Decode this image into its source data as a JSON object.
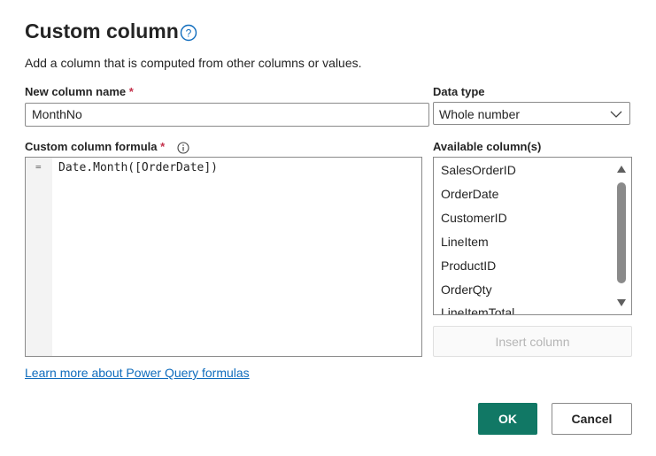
{
  "dialog": {
    "title": "Custom column",
    "description": "Add a column that is computed from other columns or values.",
    "new_column_name_label": "New column name",
    "new_column_name_value": "MonthNo",
    "required_mark": "*",
    "data_type_label": "Data type",
    "data_type_value": "Whole number",
    "formula_label": "Custom column formula",
    "formula_gutter": "=",
    "formula_value": "Date.Month([OrderDate])",
    "available_columns_label": "Available column(s)",
    "available_columns": [
      "SalesOrderID",
      "OrderDate",
      "CustomerID",
      "LineItem",
      "ProductID",
      "OrderQty",
      "LineItemTotal"
    ],
    "insert_column_label": "Insert column",
    "learn_more_link": "Learn more about Power Query formulas",
    "ok_label": "OK",
    "cancel_label": "Cancel"
  },
  "colors": {
    "accent": "#117865",
    "link": "#0f6cbd",
    "required": "#c4314b"
  }
}
